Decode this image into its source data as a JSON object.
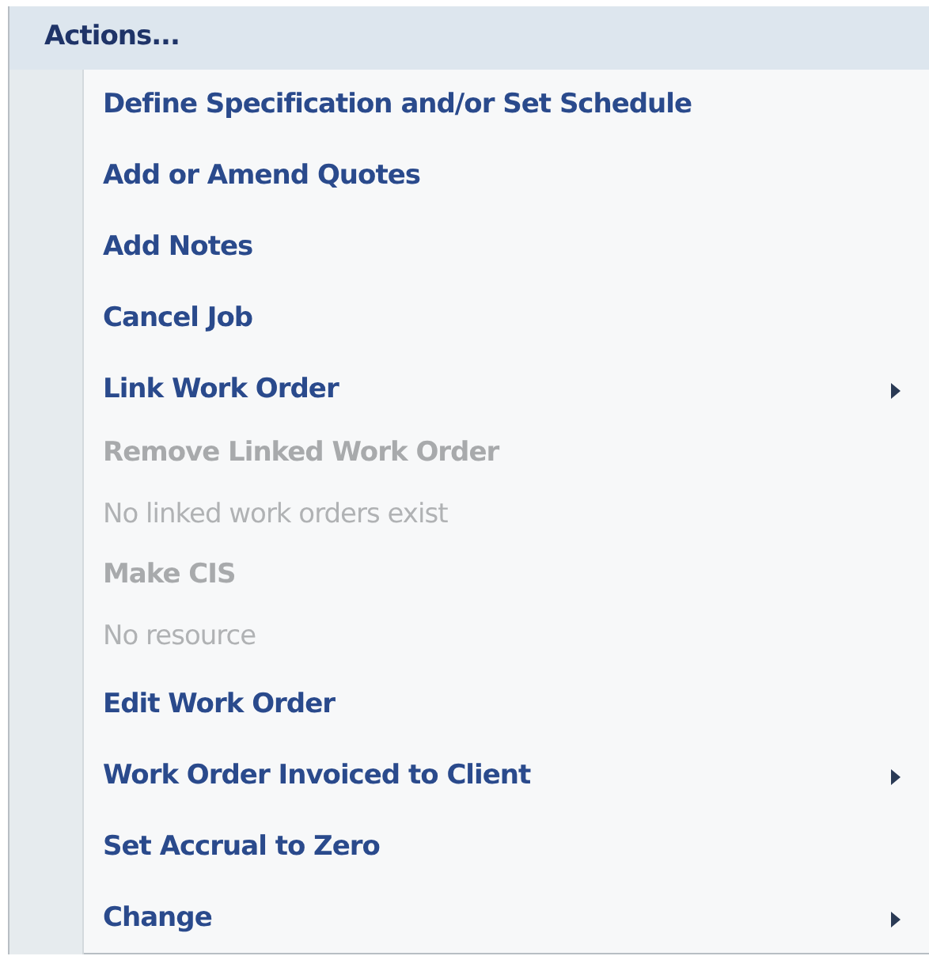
{
  "menu": {
    "title": "Actions...",
    "items": [
      {
        "label": "Define Specification and/or Set Schedule",
        "disabled": false,
        "submenu": false
      },
      {
        "label": "Add or Amend Quotes",
        "disabled": false,
        "submenu": false
      },
      {
        "label": "Add Notes",
        "disabled": false,
        "submenu": false
      },
      {
        "label": "Cancel Job",
        "disabled": false,
        "submenu": false
      },
      {
        "label": "Link Work Order",
        "disabled": false,
        "submenu": true
      },
      {
        "label": "Remove Linked Work Order",
        "disabled": true,
        "submenu": false,
        "note": "No linked work orders exist"
      },
      {
        "label": "Make CIS",
        "disabled": true,
        "submenu": false,
        "note": "No resource"
      },
      {
        "label": "Edit Work Order",
        "disabled": false,
        "submenu": false
      },
      {
        "label": "Work Order Invoiced to Client",
        "disabled": false,
        "submenu": true
      },
      {
        "label": "Set Accrual to Zero",
        "disabled": false,
        "submenu": false
      },
      {
        "label": "Change",
        "disabled": false,
        "submenu": true
      }
    ]
  }
}
